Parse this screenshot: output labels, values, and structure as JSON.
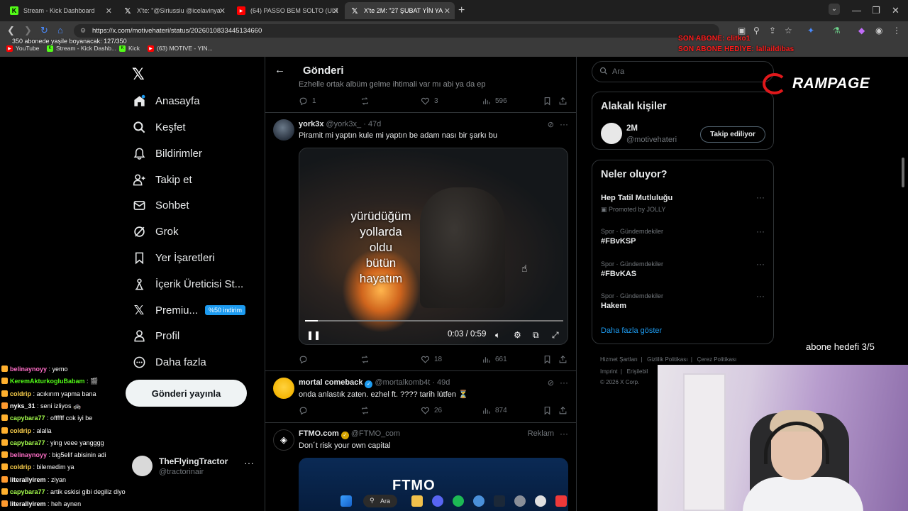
{
  "browser": {
    "tabs": [
      {
        "title": "Stream - Kick Dashboard",
        "icon": "kick-icon",
        "active": false
      },
      {
        "title": "X'te: \"@Siriussiu @icelavinya",
        "icon": "x-icon",
        "active": false
      },
      {
        "title": "(64) PASSO BEM SOLTO (ULTRA",
        "icon": "youtube-icon",
        "active": false
      },
      {
        "title": "X'te 2M: \"27 ŞUBAT YİN YA",
        "icon": "x-icon",
        "active": true
      }
    ],
    "url": "https://x.com/motivehateri/status/2026010833445134660",
    "bookmarks": [
      {
        "label": "YouTube",
        "icon": "youtube-icon"
      },
      {
        "label": "Stream - Kick Dashb...",
        "icon": "kick-icon"
      },
      {
        "label": "Kick",
        "icon": "kick-icon"
      },
      {
        "label": "(63) MOTIVE - YIN...",
        "icon": "youtube-icon"
      }
    ]
  },
  "stream_overlay": {
    "subscriber_progress": "350 abonede yaşile boyanacak: 127/350",
    "last_subscriber": "SON ABONE: clitko1",
    "last_gift": "SON ABONE HEDİYE: lallaildibas",
    "brand": "RAMPAGE",
    "sub_goal": "abone hedefi 3/5"
  },
  "sidebar": {
    "items": [
      {
        "label": "Anasayfa",
        "icon": "home-icon"
      },
      {
        "label": "Keşfet",
        "icon": "search-icon"
      },
      {
        "label": "Bildirimler",
        "icon": "bell-icon"
      },
      {
        "label": "Takip et",
        "icon": "add-user-icon"
      },
      {
        "label": "Sohbet",
        "icon": "mail-icon"
      },
      {
        "label": "Grok",
        "icon": "grok-icon"
      },
      {
        "label": "Yer İşaretleri",
        "icon": "bookmark-icon"
      },
      {
        "label": "İçerik Üreticisi St...",
        "icon": "creator-studio-icon"
      },
      {
        "label": "Premiu...",
        "icon": "x-icon"
      },
      {
        "label": "Profil",
        "icon": "person-icon"
      },
      {
        "label": "Daha fazla",
        "icon": "more-circle-icon"
      }
    ],
    "premium_badge": "%50 indirim",
    "post_button": "Gönderi yayınla",
    "account": {
      "name": "TheFlyingTractor",
      "handle": "@tractorinair"
    }
  },
  "main": {
    "title": "Gönderi",
    "previous_text": "Ezhelle ortak albüm gelme ihtimali var mı abi ya da ep",
    "previous_stats": {
      "replies": "1",
      "reposts": "",
      "likes": "3",
      "views": "596"
    },
    "tweets": [
      {
        "name": "york3x",
        "handle": "@york3x_ · 47d",
        "text": "Piramit mi yaptın kule mi yaptın be adam nası bir şarkı bu",
        "video": {
          "lyric": "yürüdüğüm\nyollarda\noldu\nbütün\nhayatım",
          "time": "0:03 / 0:59",
          "progress": 0.05
        },
        "stats": {
          "replies": "",
          "reposts": "",
          "likes": "18",
          "views": "661"
        }
      },
      {
        "name": "mortal comeback",
        "handle": "@mortalkomb4t · 49d",
        "text": "onda anlastık zaten. ezhel ft. ???? tarih lütfen ⏳",
        "stats": {
          "replies": "",
          "reposts": "",
          "likes": "26",
          "views": "874"
        }
      },
      {
        "name": "FTMO.com",
        "handle": "@FTMO_com",
        "text": "Don´t risk your own capital",
        "ad_label": "Reklam",
        "banner": "FTMO"
      }
    ]
  },
  "right": {
    "search_placeholder": "Ara",
    "relevant": {
      "title": "Alakalı kişiler",
      "name": "2M",
      "handle": "@motivehateri",
      "follow_label": "Takip ediliyor"
    },
    "trends": {
      "title": "Neler oluyor?",
      "items": [
        {
          "context": "",
          "name": "Hep Tatil Mutluluğu",
          "promoted": "Promoted by JOLLY"
        },
        {
          "context": "Spor · Gündemdekiler",
          "name": "#FBvKSP"
        },
        {
          "context": "Spor · Gündemdekiler",
          "name": "#FBvKAS"
        },
        {
          "context": "Spor · Gündemdekiler",
          "name": "Hakem"
        }
      ],
      "show_more": "Daha fazla göster"
    },
    "footer": {
      "line1": [
        "Hizmet Şartları",
        "Gizlilik Politikası",
        "Çerez Politikası"
      ],
      "line2": [
        "Imprint",
        "Erişilebil"
      ],
      "copyright": "© 2026 X Corp."
    }
  },
  "chat": [
    {
      "user": "belinaynoyy",
      "msg": ": yemo",
      "color": "#ff6ec7"
    },
    {
      "user": "KeremAkturkogluBabam",
      "msg": ": 🎬",
      "color": "#53fc18"
    },
    {
      "user": "coldrip",
      "msg": ": acıkırım yapma bana",
      "color": "#ffd34d"
    },
    {
      "user": "nyks_31",
      "msg": ": seni izliyos 🚓",
      "color": "#ffffff"
    },
    {
      "user": "capybara77",
      "msg": ": offffff cok iyi be",
      "color": "#a6ff4d"
    },
    {
      "user": "coldrip",
      "msg": ": alalla",
      "color": "#ffd34d"
    },
    {
      "user": "capybara77",
      "msg": ": ying veee yangggg",
      "color": "#a6ff4d"
    },
    {
      "user": "belinaynoyy",
      "msg": ": big5elif abisinin adi",
      "color": "#ff6ec7"
    },
    {
      "user": "coldrip",
      "msg": ": bilemedim ya",
      "color": "#ffd34d"
    },
    {
      "user": "literallyirem",
      "msg": ": ziyan",
      "color": "#ffffff"
    },
    {
      "user": "capybara77",
      "msg": ": artik eskisi gibi degiliz diyo",
      "color": "#a6ff4d"
    },
    {
      "user": "literallyirem",
      "msg": ": heh aynen",
      "color": "#ffffff"
    }
  ],
  "taskbar": {
    "search_label": "Ara"
  }
}
